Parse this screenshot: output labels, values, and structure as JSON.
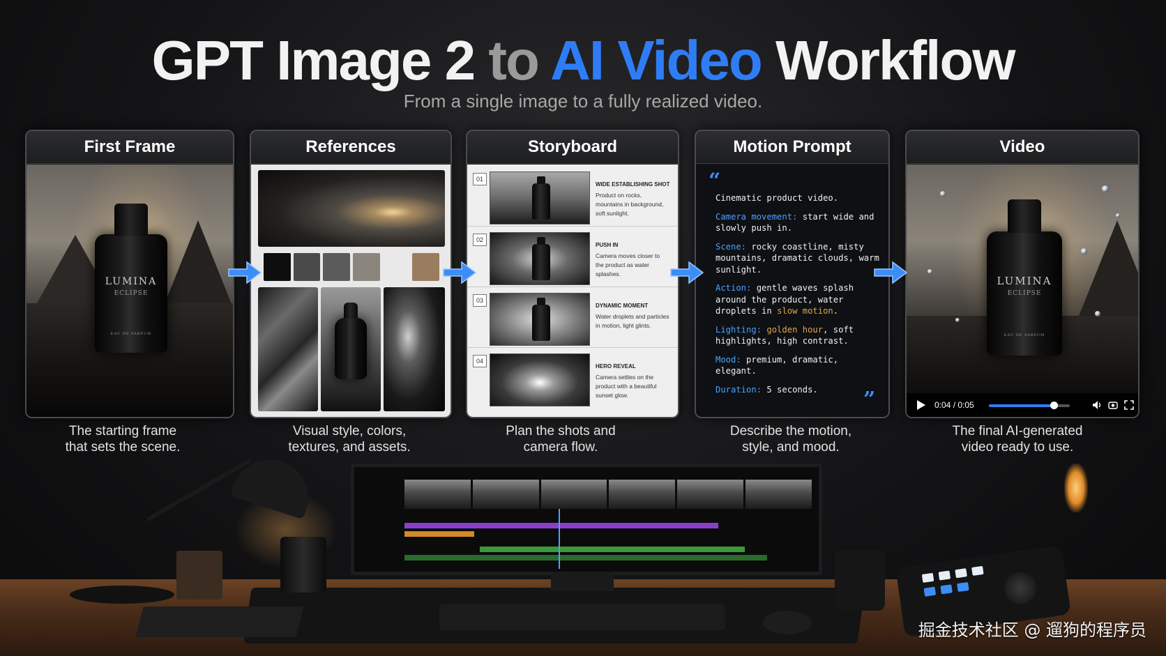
{
  "header": {
    "title_part1": "GPT Image 2",
    "title_part2": "to",
    "title_part3": "AI Video",
    "title_part4": "Workflow",
    "subtitle": "From a single image to a fully realized video.",
    "accent_color": "#2f7df6"
  },
  "cards": {
    "first_frame": {
      "title": "First Frame",
      "caption_line1": "The starting frame",
      "caption_line2": "that sets the scene.",
      "bottle_brand": "LUMINA",
      "bottle_sub": "ECLIPSE",
      "bottle_small": "EAU DE PARFUM"
    },
    "references": {
      "title": "References",
      "caption_line1": "Visual style, colors,",
      "caption_line2": "textures, and assets.",
      "swatches": [
        "#0e0e0f",
        "#4a4a4b",
        "#5b5b5c",
        "#8a857d",
        "#2a2824",
        "#9a7c5e"
      ]
    },
    "storyboard": {
      "title": "Storyboard",
      "caption_line1": "Plan the shots and",
      "caption_line2": "camera flow.",
      "shots": [
        {
          "num": "01",
          "head": "WIDE ESTABLISHING SHOT",
          "text": "Product on rocks, mountains in background, soft sunlight."
        },
        {
          "num": "02",
          "head": "PUSH IN",
          "text": "Camera moves closer to the product as water splashes."
        },
        {
          "num": "03",
          "head": "DYNAMIC MOMENT",
          "text": "Water droplets and particles in motion, light glints."
        },
        {
          "num": "04",
          "head": "HERO REVEAL",
          "text": "Camera settles on the product with a beautiful sunset glow."
        }
      ]
    },
    "motion_prompt": {
      "title": "Motion Prompt",
      "caption_line1": "Describe the motion,",
      "caption_line2": "style, and mood.",
      "open_quote": "“",
      "close_quote": "”",
      "intro": "Cinematic product video.",
      "camera_key": "Camera movement:",
      "camera_val": " start wide and slowly push in.",
      "scene_key": "Scene:",
      "scene_val": " rocky coastline, misty mountains, dramatic clouds, warm sunlight.",
      "action_key": "Action:",
      "action_val": " gentle waves splash around the product, water droplets in ",
      "action_hl": "slow motion",
      "action_end": ".",
      "lighting_key": "Lighting:",
      "lighting_hl": " golden hour",
      "lighting_val": ", soft highlights, high contrast.",
      "mood_key": "Mood:",
      "mood_val": " premium, dramatic, elegant.",
      "duration_key": "Duration:",
      "duration_val": " 5 seconds."
    },
    "video": {
      "title": "Video",
      "caption_line1": "The final AI-generated",
      "caption_line2": "video ready to use.",
      "time_label": "0:04 / 0:05",
      "progress": 0.8,
      "bottle_brand": "LUMINA",
      "bottle_sub": "ECLIPSE",
      "bottle_small": "EAU DE PARFUM"
    }
  },
  "icons": {
    "arrow": "arrow-right-icon",
    "play": "play-icon",
    "volume": "volume-icon",
    "screenshot": "camera-icon",
    "fullscreen": "fullscreen-icon"
  },
  "watermark": "掘金技术社区 @ 遛狗的程序员"
}
